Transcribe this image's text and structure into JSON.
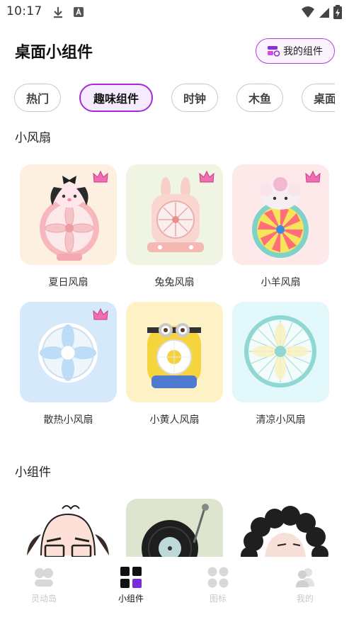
{
  "status_bar": {
    "time": "10:17"
  },
  "header": {
    "title": "桌面小组件",
    "my_widgets_label": "我的组件"
  },
  "tabs": [
    {
      "label": "热门"
    },
    {
      "label": "趣味组件"
    },
    {
      "label": "时钟"
    },
    {
      "label": "木鱼"
    },
    {
      "label": "桌面"
    }
  ],
  "sections": {
    "fans_title": "小风扇",
    "widgets_title": "小组件"
  },
  "fans": [
    {
      "label": "夏日风扇"
    },
    {
      "label": "兔兔风扇"
    },
    {
      "label": "小羊风扇"
    },
    {
      "label": "散热小风扇"
    },
    {
      "label": "小黄人风扇"
    },
    {
      "label": "清凉小风扇"
    }
  ],
  "bottom_nav": [
    {
      "label": "灵动岛"
    },
    {
      "label": "小组件"
    },
    {
      "label": "图标"
    },
    {
      "label": "我的"
    }
  ],
  "colors": {
    "accent": "#a52bd6",
    "crown": "#f26bb3"
  }
}
